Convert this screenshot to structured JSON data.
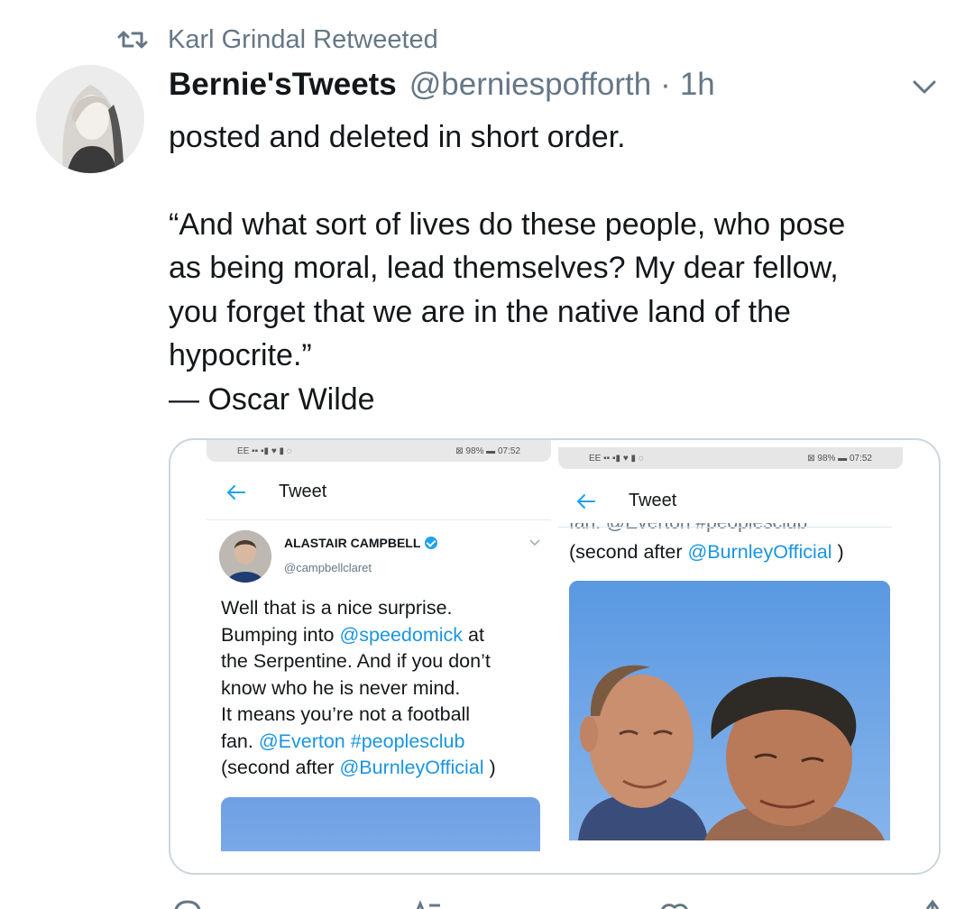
{
  "retweet": {
    "label": "Karl Grindal Retweeted",
    "icon": "retweet-icon"
  },
  "tweet": {
    "display_name": "Bernie'sTweets",
    "handle": "@berniespofforth",
    "separator": "·",
    "time": "1h",
    "paragraph_1": "posted and deleted in short order.",
    "paragraph_2": "“And what sort of lives do these people, who pose\nas being moral, lead themselves? My dear fellow,\nyou forget that we are in the native land of the\nhypocrite.”\n— Oscar Wilde"
  },
  "media": {
    "left_screenshot": {
      "status_left": "EE ▪▪ ▪▮ ♥ ▮ ◌",
      "status_right": "⊠ 98% ▬ 07:52",
      "title": "Tweet",
      "author_name": "ALASTAIR CAMPBELL",
      "author_handle": "@campbellclaret",
      "text_1": "Well that is a nice surprise.\nBumping into ",
      "mention_1": "@speedomick",
      "text_2": " at\nthe Serpentine. And if you don’t\nknow who he is never mind.\nIt means you’re not a football\nfan. ",
      "mention_2": "@Everton",
      "hashtag": "#peoplesclub",
      "text_3": "\n(second after ",
      "mention_3": "@BurnleyOfficial",
      "text_4": " )"
    },
    "right_screenshot": {
      "status_left": "EE ▪▪ ▪▮ ♥ ▮ ◌",
      "status_right": "⊠ 98% ▬ 07:52",
      "title": "Tweet",
      "cut_line": "fan. @Everton #peoplesclub",
      "line_prefix": "(second after ",
      "line_mention": "@BurnleyOfficial",
      "line_suffix": " )"
    }
  },
  "colors": {
    "text": "#14171a",
    "secondary": "#657786",
    "link": "#1b95e0",
    "border": "#ccd6dd"
  }
}
